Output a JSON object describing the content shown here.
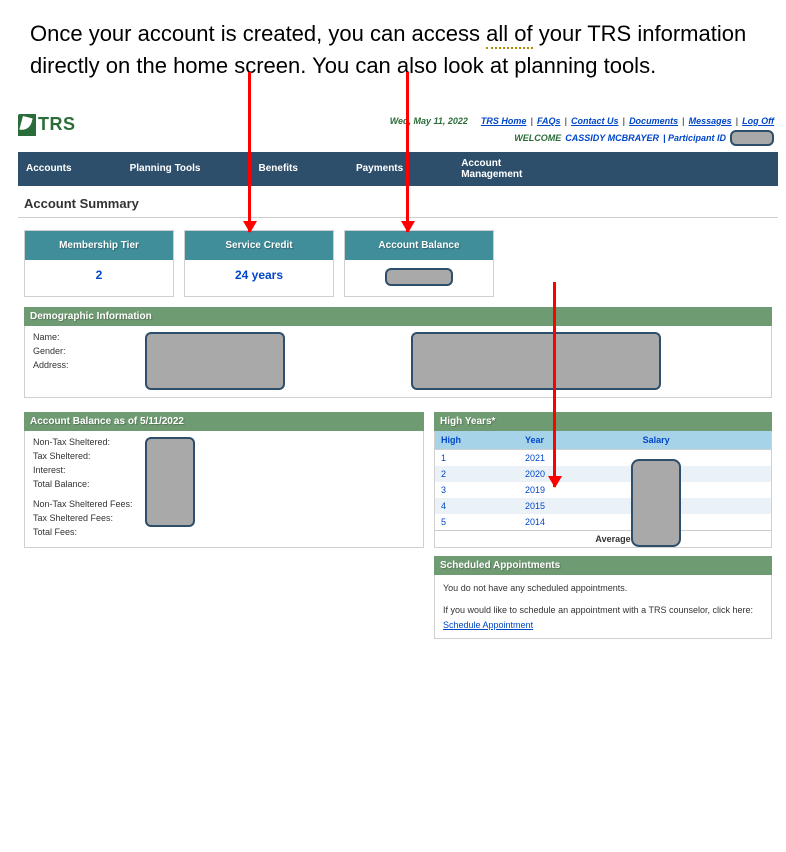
{
  "intro": {
    "before_underline": "Once your account is created, you can access ",
    "underline": "all of",
    "after_underline": " your TRS information directly on the home screen. You can also look at planning tools."
  },
  "logo_text": "TRS",
  "topbar": {
    "date": "Wed, May 11, 2022",
    "links": [
      "TRS Home",
      "FAQs",
      "Contact Us",
      "Documents",
      "Messages",
      "Log Off"
    ]
  },
  "welcome": {
    "label": "WELCOME",
    "name": "CASSIDY MCBRAYER",
    "pid_label": "Participant ID"
  },
  "nav": [
    "Accounts",
    "Planning Tools",
    "Benefits",
    "Payments",
    "Account Management"
  ],
  "page_heading": "Account Summary",
  "tiles": [
    {
      "head": "Membership Tier",
      "value": "2"
    },
    {
      "head": "Service Credit",
      "value": "24 years"
    },
    {
      "head": "Account Balance",
      "value": ""
    }
  ],
  "sections": {
    "demographic": {
      "title": "Demographic Information",
      "labels": [
        "Name:",
        "Gender:",
        "Address:"
      ]
    },
    "balance": {
      "title": "Account Balance as of 5/11/2022",
      "labels_top": [
        "Non-Tax Sheltered:",
        "Tax Sheltered:",
        "Interest:",
        "Total Balance:"
      ],
      "labels_bottom": [
        "Non-Tax Sheltered Fees:",
        "Tax Sheltered Fees:",
        "Total Fees:"
      ]
    },
    "high_years": {
      "title": "High Years*",
      "cols": [
        "High",
        "Year",
        "Salary"
      ],
      "rows": [
        {
          "high": "1",
          "year": "2021"
        },
        {
          "high": "2",
          "year": "2020"
        },
        {
          "high": "3",
          "year": "2019"
        },
        {
          "high": "4",
          "year": "2015"
        },
        {
          "high": "5",
          "year": "2014"
        }
      ],
      "avg_label": "Average"
    },
    "appointments": {
      "title": "Scheduled Appointments",
      "no_appts": "You do not have any scheduled appointments.",
      "schedule_text": "If you would like to schedule an appointment with a TRS counselor, click here: ",
      "schedule_link": "Schedule Appointment"
    }
  }
}
